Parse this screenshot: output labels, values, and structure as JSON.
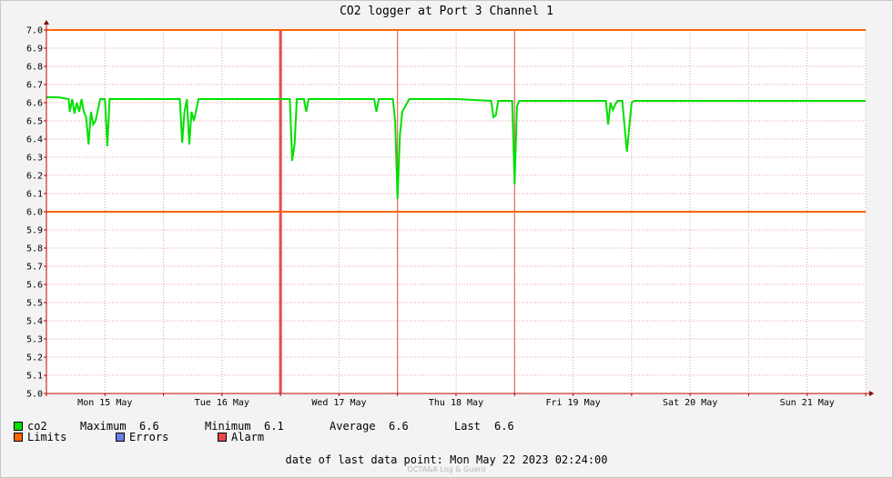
{
  "chart_data": {
    "type": "line",
    "title": "CO2 logger at Port 3 Channel 1",
    "xlabel": "",
    "ylabel": "",
    "ylim": [
      5.0,
      7.0
    ],
    "y_ticks": [
      "7.0",
      "6.9",
      "6.8",
      "6.7",
      "6.6",
      "6.5",
      "6.4",
      "6.3",
      "6.2",
      "6.1",
      "6.0",
      "5.9",
      "5.8",
      "5.7",
      "5.6",
      "5.5",
      "5.4",
      "5.3",
      "5.2",
      "5.1",
      "5.0"
    ],
    "x_ticks": [
      "Mon 15 May",
      "Tue 16 May",
      "Wed 17 May",
      "Thu 18 May",
      "Fri 19 May",
      "Sat 20 May",
      "Sun 21 May"
    ],
    "xlim_days": [
      0,
      7.0
    ],
    "grid": true,
    "limits": [
      6.0,
      7.0
    ],
    "alarms": [
      2.0,
      3.0,
      4.0
    ],
    "series": [
      {
        "name": "co2",
        "color": "#00e000",
        "x": [
          0.0,
          0.1,
          0.19,
          0.2,
          0.22,
          0.24,
          0.26,
          0.28,
          0.3,
          0.32,
          0.34,
          0.36,
          0.38,
          0.4,
          0.42,
          0.46,
          0.5,
          0.52,
          0.54,
          0.6,
          1.0,
          1.14,
          1.16,
          1.18,
          1.2,
          1.22,
          1.24,
          1.26,
          1.3,
          1.5,
          2.0,
          2.08,
          2.1,
          2.12,
          2.14,
          2.2,
          2.22,
          2.24,
          2.3,
          2.5,
          2.8,
          2.82,
          2.84,
          2.96,
          2.98,
          3.0,
          3.02,
          3.04,
          3.1,
          3.5,
          3.8,
          3.82,
          3.84,
          3.86,
          3.96,
          3.98,
          4.0,
          4.02,
          4.04,
          4.1,
          4.5,
          4.78,
          4.8,
          4.82,
          4.84,
          4.86,
          4.88,
          4.92,
          4.96,
          5.0,
          5.02,
          5.1,
          5.5,
          6.0,
          6.5,
          7.0
        ],
        "values": [
          6.63,
          6.63,
          6.62,
          6.55,
          6.62,
          6.54,
          6.6,
          6.55,
          6.62,
          6.55,
          6.52,
          6.37,
          6.55,
          6.48,
          6.5,
          6.62,
          6.62,
          6.36,
          6.62,
          6.62,
          6.62,
          6.62,
          6.38,
          6.55,
          6.62,
          6.37,
          6.55,
          6.5,
          6.62,
          6.62,
          6.62,
          6.62,
          6.28,
          6.37,
          6.62,
          6.62,
          6.55,
          6.62,
          6.62,
          6.62,
          6.62,
          6.55,
          6.62,
          6.62,
          6.5,
          6.07,
          6.42,
          6.55,
          6.62,
          6.62,
          6.61,
          6.52,
          6.53,
          6.61,
          6.61,
          6.61,
          6.15,
          6.58,
          6.61,
          6.61,
          6.61,
          6.61,
          6.48,
          6.6,
          6.56,
          6.59,
          6.61,
          6.61,
          6.33,
          6.6,
          6.61,
          6.61,
          6.61,
          6.61,
          6.61,
          6.61
        ]
      }
    ],
    "legend": {
      "co2": "co2",
      "maximum_label": "Maximum",
      "maximum": "6.6",
      "minimum_label": "Minimum",
      "minimum": "6.1",
      "average_label": "Average",
      "average": "6.6",
      "last_label": "Last",
      "last": "6.6",
      "limits": "Limits",
      "errors": "Errors",
      "alarm": "Alarm"
    },
    "colors": {
      "co2": "#00e000",
      "limits": "#ff6600",
      "errors": "#6b7fe0",
      "alarm": "#ea4848"
    }
  },
  "footer": {
    "label": "date of last data point:",
    "value": "Mon May 22 2023 02:24:00"
  },
  "watermark": "OCTA&A Log & Guard"
}
